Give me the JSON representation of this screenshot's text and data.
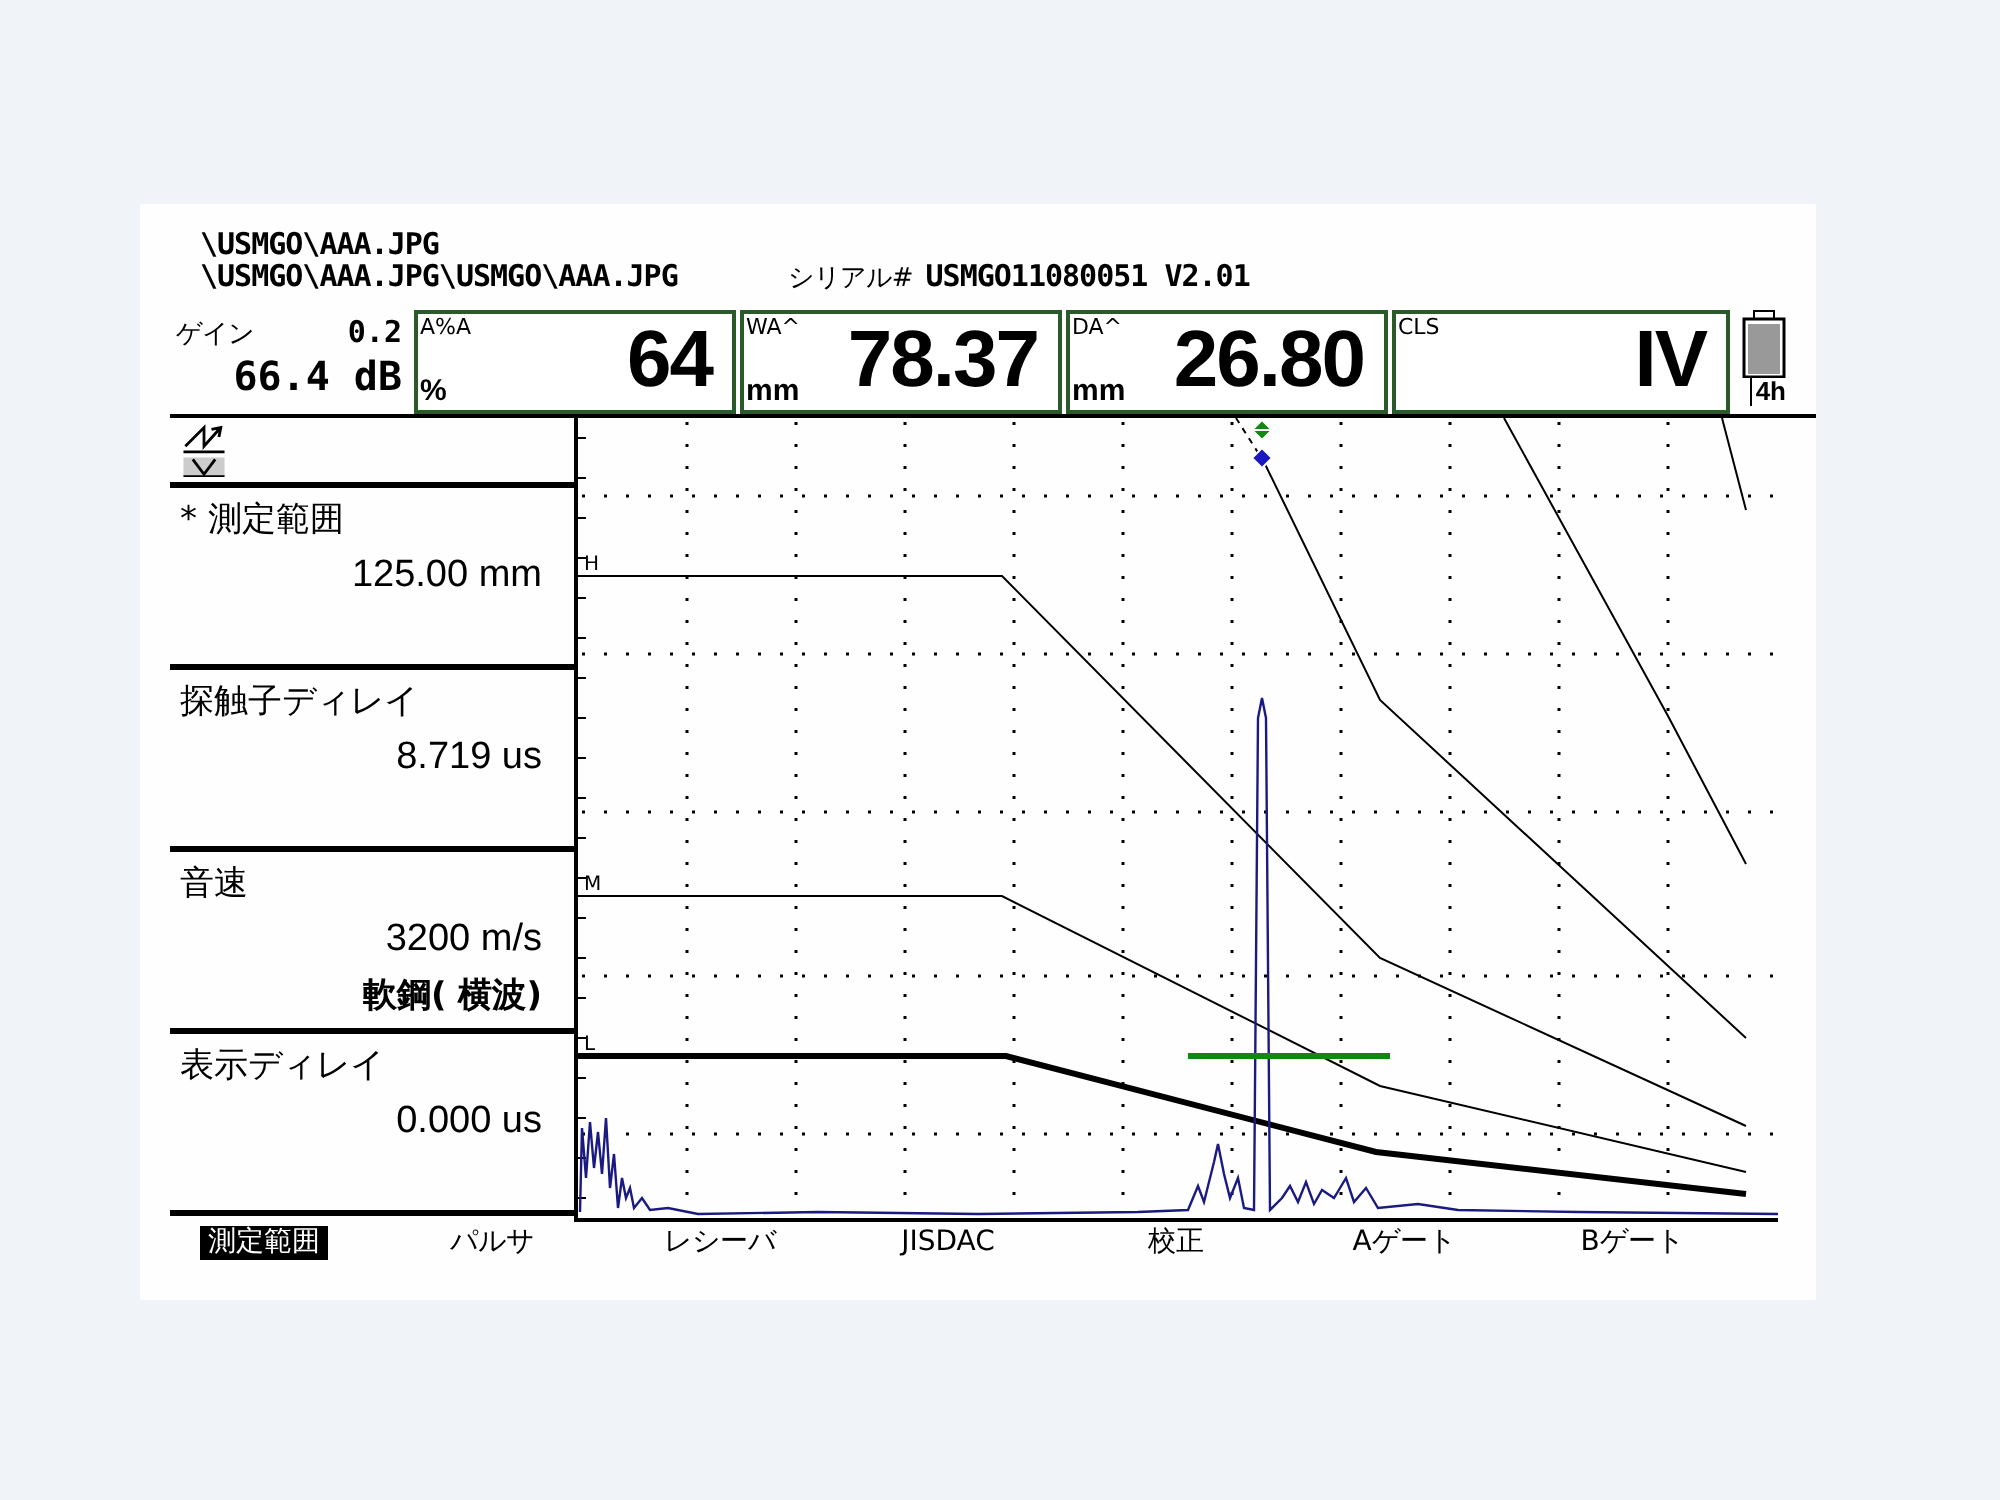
{
  "header": {
    "file_line": "\\USMGO\\AAA.JPG",
    "path_line": "\\USMGO\\AAA.JPG\\USMGO\\AAA.JPG",
    "serial_label": "シリアル#",
    "serial_value": "USMGO11080051 V2.01"
  },
  "gain": {
    "label": "ゲイン",
    "step": "0.2",
    "value": "66.4 dB"
  },
  "readouts": [
    {
      "label": "A%A",
      "unit": "%",
      "value": "64"
    },
    {
      "label": "WA^",
      "unit": "mm",
      "value": "78.37"
    },
    {
      "label": "DA^",
      "unit": "mm",
      "value": "26.80"
    },
    {
      "label": "CLS",
      "value": "IV"
    }
  ],
  "battery": {
    "time": "4h"
  },
  "parameters": [
    {
      "label": "* 測定範囲",
      "values": [
        "125.00 mm"
      ]
    },
    {
      "label": "探触子ディレイ",
      "values": [
        "8.719 us"
      ]
    },
    {
      "label": "音速",
      "values": [
        "3200 m/s",
        "軟鋼( 横波)"
      ]
    },
    {
      "label": "表示ディレイ",
      "values": [
        "0.000 us"
      ]
    }
  ],
  "ascan": {
    "curve_labels": [
      "H",
      "M",
      "L"
    ]
  },
  "menu": [
    {
      "label": "測定範囲",
      "selected": true
    },
    {
      "label": "パルサ",
      "selected": false
    },
    {
      "label": "レシーバ",
      "selected": false
    },
    {
      "label": "JISDAC",
      "selected": false
    },
    {
      "label": "校正",
      "selected": false
    },
    {
      "label": "Aゲート",
      "selected": false
    },
    {
      "label": "Bゲート",
      "selected": false
    }
  ]
}
